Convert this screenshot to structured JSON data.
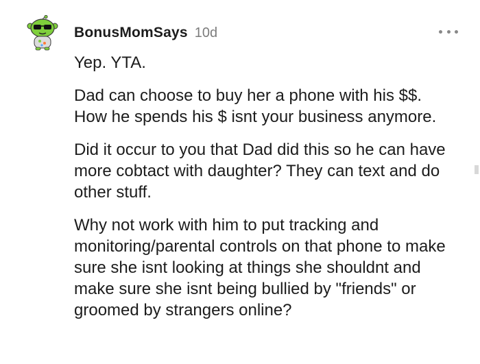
{
  "comment": {
    "username": "BonusMomSays",
    "age": "10d",
    "paragraphs": [
      "Yep. YTA.",
      "Dad can choose to buy her a phone with his $$. How he spends his $ isnt your business anymore.",
      "Did it occur to you that Dad did this so he can have more cobtact with daughter? They can text and do other stuff.",
      "Why not work with him to put tracking and monitoring/parental controls on that phone to make sure she isnt looking at things she shouldnt and make sure she isnt being bullied by \"friends\" or groomed by strangers online?"
    ]
  },
  "icons": {
    "avatar": "snoo-avatar-sunglasses",
    "more": "more-options-icon"
  },
  "colors": {
    "text": "#1c1c1c",
    "meta": "#7c7c7c",
    "avatar_green": "#7fcf3c"
  }
}
